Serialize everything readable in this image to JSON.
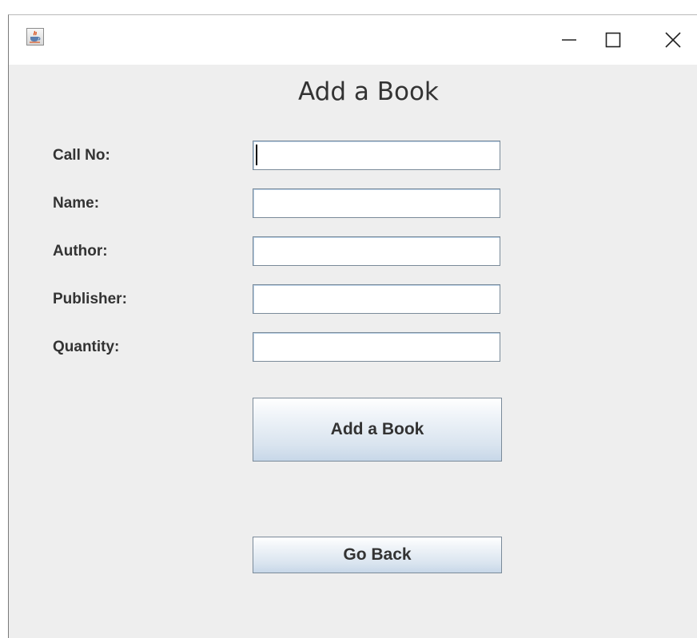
{
  "window": {
    "title": "",
    "controls": {
      "minimize": "minimize",
      "maximize": "maximize",
      "close": "close"
    }
  },
  "form": {
    "heading": "Add a Book",
    "fields": [
      {
        "label": "Call No:",
        "value": ""
      },
      {
        "label": "Name:",
        "value": ""
      },
      {
        "label": "Author:",
        "value": ""
      },
      {
        "label": "Publisher:",
        "value": ""
      },
      {
        "label": "Quantity:",
        "value": ""
      }
    ],
    "add_button_label": "Add a Book",
    "back_button_label": "Go Back"
  },
  "colors": {
    "window_bg": "#eeeeee",
    "button_gradient_top": "#ffffff",
    "button_gradient_bottom": "#c7d7e8",
    "field_border": "#7a8a99"
  },
  "icons": {
    "app": "java-coffee-cup-icon",
    "minimize": "minimize-icon",
    "maximize": "maximize-icon",
    "close": "close-icon"
  }
}
